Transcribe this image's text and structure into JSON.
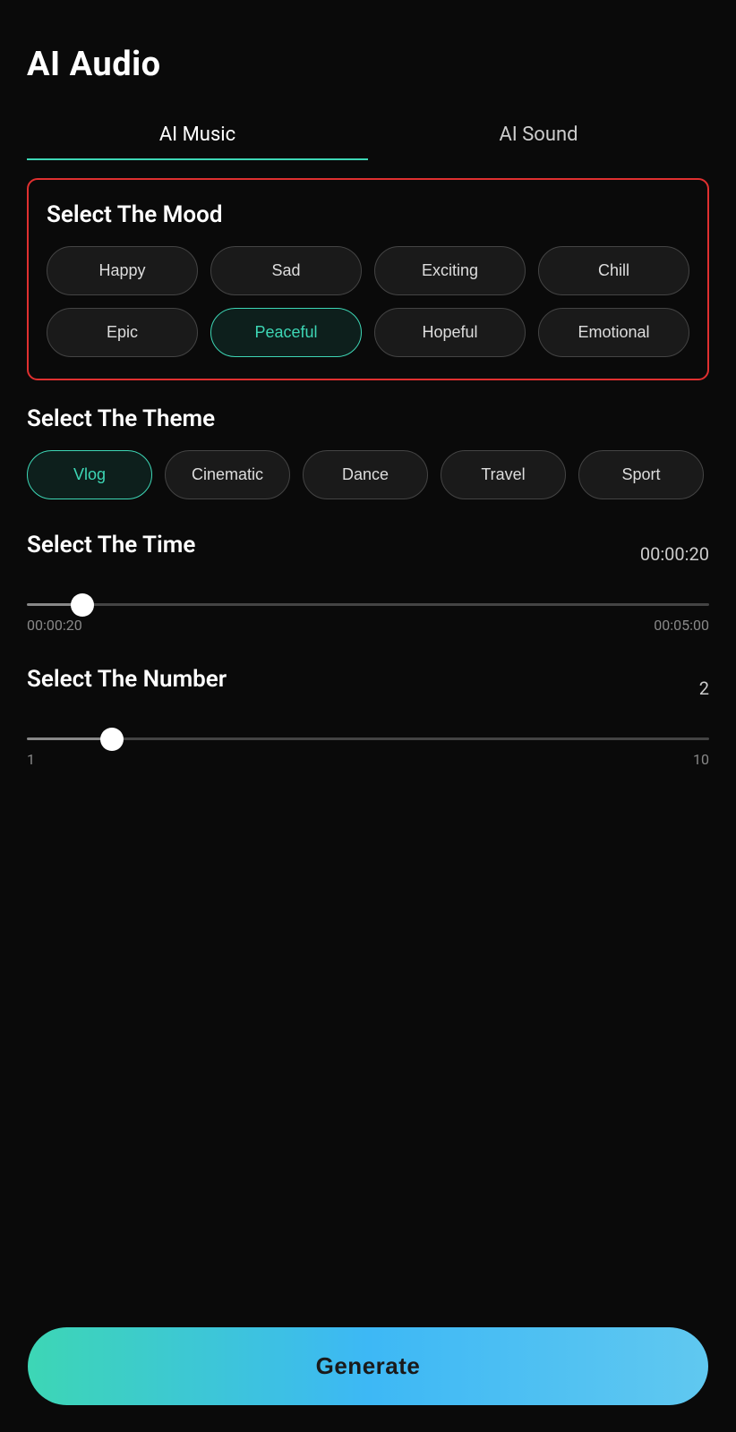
{
  "page": {
    "title": "AI Audio"
  },
  "tabs": [
    {
      "id": "ai-music",
      "label": "AI Music",
      "active": true
    },
    {
      "id": "ai-sound",
      "label": "AI Sound",
      "active": false
    }
  ],
  "mood": {
    "section_title": "Select The Mood",
    "items": [
      {
        "id": "happy",
        "label": "Happy",
        "selected": false
      },
      {
        "id": "sad",
        "label": "Sad",
        "selected": false
      },
      {
        "id": "exciting",
        "label": "Exciting",
        "selected": false
      },
      {
        "id": "chill",
        "label": "Chill",
        "selected": false
      },
      {
        "id": "epic",
        "label": "Epic",
        "selected": false
      },
      {
        "id": "peaceful",
        "label": "Peaceful",
        "selected": true
      },
      {
        "id": "hopeful",
        "label": "Hopeful",
        "selected": false
      },
      {
        "id": "emotional",
        "label": "Emotional",
        "selected": false
      }
    ]
  },
  "theme": {
    "section_title": "Select The Theme",
    "items": [
      {
        "id": "vlog",
        "label": "Vlog",
        "selected": true
      },
      {
        "id": "cinematic",
        "label": "Cinematic",
        "selected": false
      },
      {
        "id": "dance",
        "label": "Dance",
        "selected": false
      },
      {
        "id": "travel",
        "label": "Travel",
        "selected": false
      },
      {
        "id": "sport",
        "label": "Sport",
        "selected": false
      }
    ]
  },
  "time": {
    "section_title": "Select The Time",
    "current_value": "00:00:20",
    "min_label": "00:00:20",
    "max_label": "00:05:00",
    "slider_percent": 6.67
  },
  "number": {
    "section_title": "Select The Number",
    "current_value": "2",
    "min_label": "1",
    "max_label": "10",
    "slider_percent": 11.11
  },
  "generate_button": {
    "label": "Generate"
  }
}
